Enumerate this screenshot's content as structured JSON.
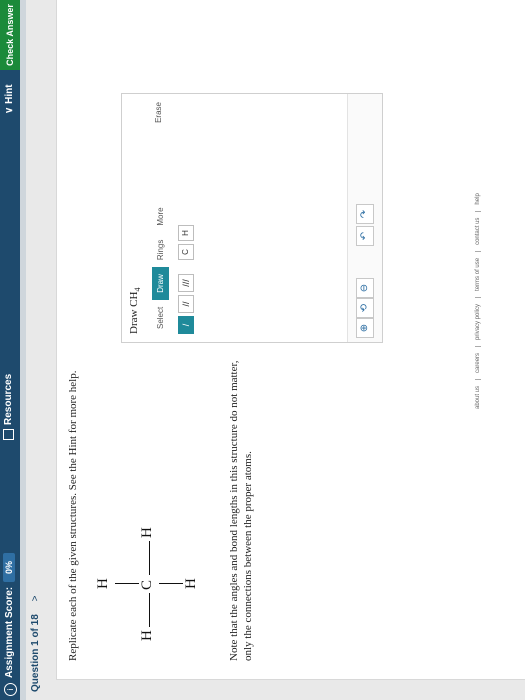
{
  "topbar": {
    "info_icon": "i",
    "score_label": "Assignment Score:",
    "score_value": "0%",
    "resources_label": "Resources",
    "hint_label": "Hint",
    "check_label": "Check Answer"
  },
  "question": {
    "header": "Question 1 of 18",
    "chevron": ">",
    "prompt": "Replicate each of the given structures. See the Hint for more help.",
    "note": "Note that the angles and bond lengths in this structure do not matter, only the connections between the proper atoms."
  },
  "structure": {
    "atoms": [
      "H",
      "C",
      "H",
      "H",
      "H"
    ]
  },
  "panel": {
    "title_prefix": "Draw CH",
    "title_sub": "4",
    "tabs": [
      "Select",
      "Draw",
      "Rings",
      "More"
    ],
    "erase": "Erase",
    "bond_tools": [
      "/",
      "//",
      "///"
    ],
    "atom_tools": [
      "C",
      "H"
    ],
    "undo": "↶",
    "redo": "↷",
    "zoom_in": "⊕",
    "zoom_reset": "⟲",
    "zoom_out": "⊖"
  },
  "footer": {
    "links": [
      "about us",
      "careers",
      "privacy policy",
      "terms of use",
      "contact us",
      "help"
    ]
  }
}
